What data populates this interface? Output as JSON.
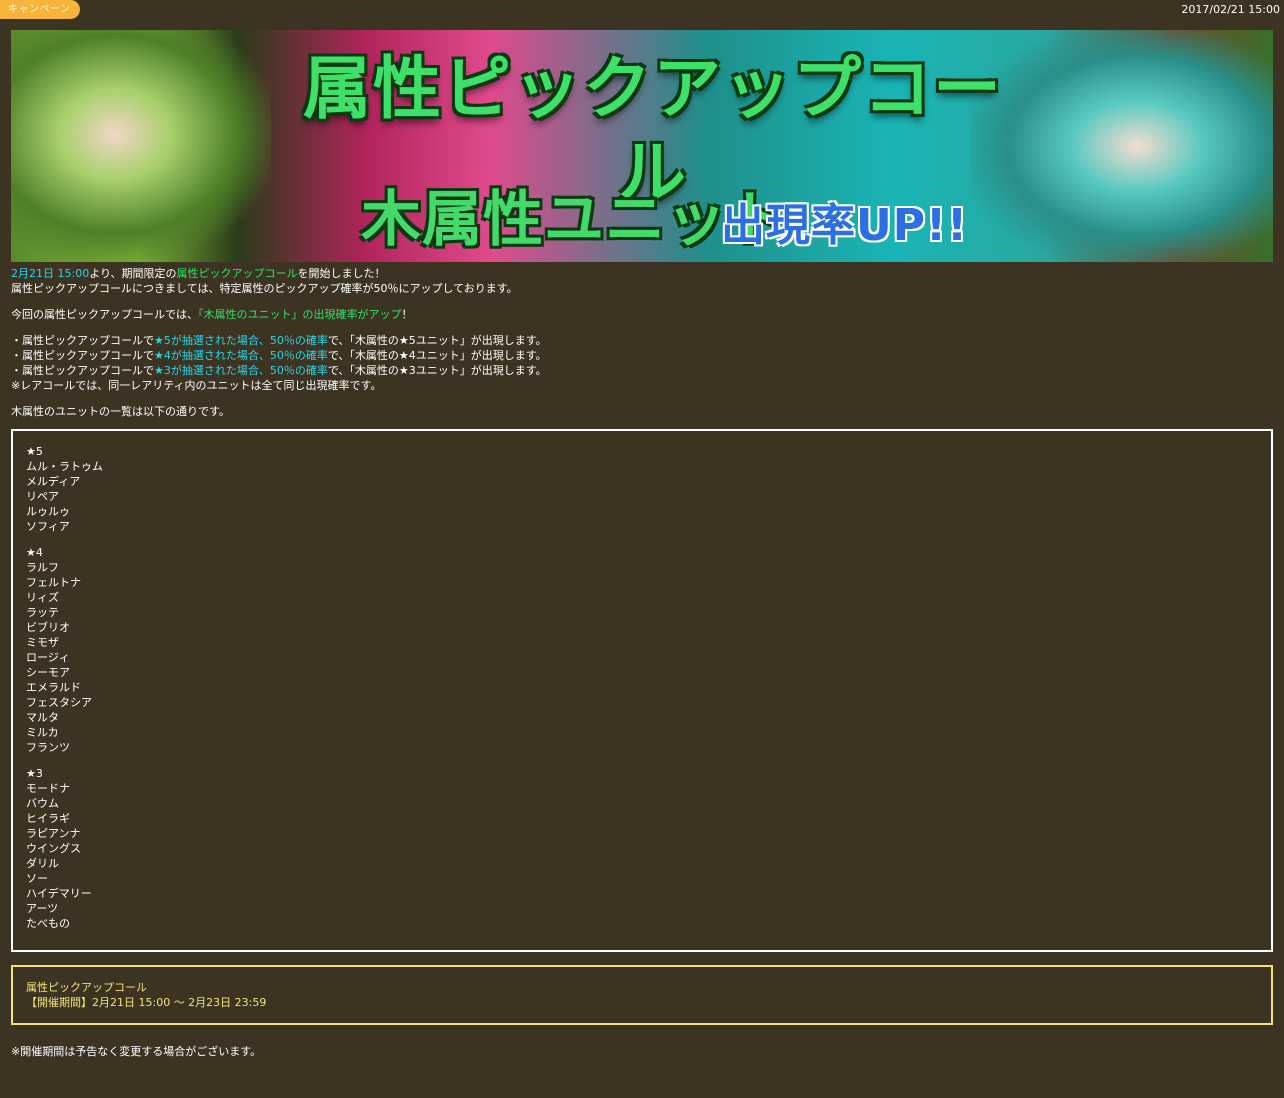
{
  "header": {
    "category_tag": "キャンペーン",
    "posted_at": "2017/02/21 15:00"
  },
  "banner": {
    "title": "属性ピックアップコール",
    "subtitle_main": "木属性ユニット",
    "subtitle_accent": "出現率UP!!"
  },
  "intro": {
    "line1_date": "2月21日 15:00",
    "line1_mid": "より、期間限定の",
    "line1_event": "属性ピックアップコール",
    "line1_end": "を開始しました！",
    "line2": "属性ピックアップコールにつきましては、特定属性のピックアップ確率が50％にアップしております。"
  },
  "highlight": {
    "prefix": "今回の属性ピックアップコールでは、",
    "emphasis": "「木属性のユニット」の出現確率がアップ",
    "suffix": "！"
  },
  "rules": [
    {
      "pre": "・属性ピックアップコールで",
      "emph": "★5が抽選された場合、50％の確率",
      "post": "で、「木属性の★5ユニット」が出現します。"
    },
    {
      "pre": "・属性ピックアップコールで",
      "emph": "★4が抽選された場合、50％の確率",
      "post": "で、「木属性の★4ユニット」が出現します。"
    },
    {
      "pre": "・属性ピックアップコールで",
      "emph": "★3が抽選された場合、50％の確率",
      "post": "で、「木属性の★3ユニット」が出現します。"
    }
  ],
  "rules_note": "※レアコールでは、同一レアリティ内のユニットは全て同じ出現確率です。",
  "list_intro": "木属性のユニットの一覧は以下の通りです。",
  "unit_groups": [
    {
      "rarity": "★5",
      "units": [
        "ムル・ラトゥム",
        "メルディア",
        "リペア",
        "ルゥルゥ",
        "ソフィア"
      ]
    },
    {
      "rarity": "★4",
      "units": [
        "ラルフ",
        "フェルトナ",
        "リィズ",
        "ラッテ",
        "ビブリオ",
        "ミモザ",
        "ロージィ",
        "シーモア",
        "エメラルド",
        "フェスタシア",
        "マルタ",
        "ミルカ",
        "フランツ"
      ]
    },
    {
      "rarity": "★3",
      "units": [
        "モードナ",
        "バウム",
        "ヒイラギ",
        "ラピアンナ",
        "ウイングス",
        "ダリル",
        "ソー",
        "ハイデマリー",
        "アーツ",
        "たべもの"
      ]
    }
  ],
  "period_box": {
    "event_name": "属性ピックアップコール",
    "period": "【開催期間】2月21日 15:00 ～ 2月23日 23:59"
  },
  "footer_note": "※開催期間は予告なく変更する場合がございます。",
  "colors": {
    "background": "#3d3323",
    "accent_cyan": "#29d6e8",
    "accent_green": "#33e066",
    "period_yellow": "#f4e27a",
    "tag_orange": "#f6b43a"
  }
}
